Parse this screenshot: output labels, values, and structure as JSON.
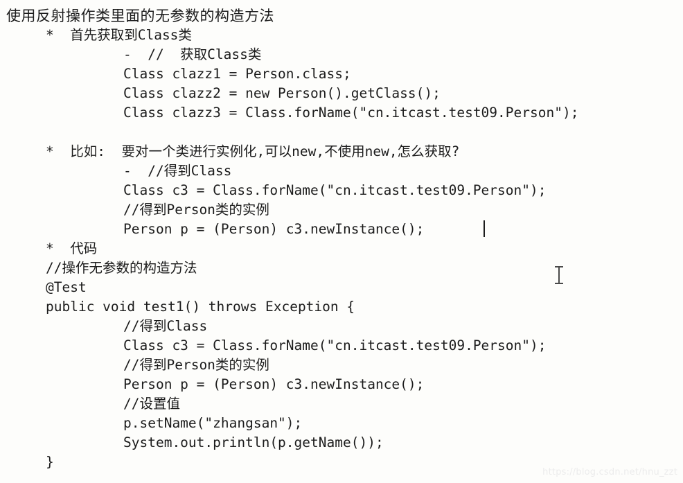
{
  "document": {
    "title_line": "使用反射操作类里面的无参数的构造方法",
    "watermark": "https://blog.csdn.net/hnu_zzt",
    "background_color": "#fdfdfb",
    "text_color": "#1c1c1c",
    "lines": [
      {
        "text": "使用反射操作类里面的无参数的构造方法",
        "indent": 0,
        "title": true,
        "italic": false,
        "blank": false
      },
      {
        "text": "*  首先获取到Class类",
        "indent": 1,
        "title": false,
        "italic": false,
        "blank": false
      },
      {
        "text": "-  //  获取Class类",
        "indent": 2,
        "title": false,
        "italic": false,
        "blank": false
      },
      {
        "text": "Class clazz1 = Person.class;",
        "indent": 2,
        "title": false,
        "italic": false,
        "blank": false
      },
      {
        "text": "Class clazz2 = new Person().getClass();",
        "indent": 2,
        "title": false,
        "italic": false,
        "blank": false
      },
      {
        "text": "Class clazz3 = Class.forName(\"cn.itcast.test09.Person\");",
        "indent": 2,
        "title": false,
        "italic": false,
        "blank": false
      },
      {
        "text": " ",
        "indent": 0,
        "title": false,
        "italic": false,
        "blank": true
      },
      {
        "text": "*  比如:  要对一个类进行实例化,可以new,不使用new,怎么获取?",
        "indent": 1,
        "title": false,
        "italic": false,
        "blank": false
      },
      {
        "text": "-  //得到Class",
        "indent": 2,
        "title": false,
        "italic": false,
        "blank": false
      },
      {
        "text": "Class c3 = Class.forName(\"cn.itcast.test09.Person\");",
        "indent": 2,
        "title": false,
        "italic": false,
        "blank": false
      },
      {
        "text": "//得到Person类的实例",
        "indent": 2,
        "title": false,
        "italic": false,
        "blank": false
      },
      {
        "text": "Person p = (Person) c3.newInstance();",
        "indent": 2,
        "title": false,
        "italic": false,
        "blank": false
      },
      {
        "text": "*  代码",
        "indent": 1,
        "title": false,
        "italic": false,
        "blank": false
      },
      {
        "text": "//操作无参数的构造方法",
        "indent": 1,
        "title": false,
        "italic": false,
        "blank": false
      },
      {
        "text": "@Test",
        "indent": 1,
        "title": false,
        "italic": false,
        "blank": false
      },
      {
        "text": "public void test1() throws Exception {",
        "indent": 1,
        "title": false,
        "italic": false,
        "blank": false
      },
      {
        "text": "//得到Class",
        "indent": 2,
        "title": false,
        "italic": false,
        "blank": false
      },
      {
        "text": "Class c3 = Class.forName(\"cn.itcast.test09.Person\");",
        "indent": 2,
        "title": false,
        "italic": false,
        "blank": false
      },
      {
        "text": "//得到Person类的实例",
        "indent": 2,
        "title": false,
        "italic": false,
        "blank": false
      },
      {
        "text": "Person p = (Person) c3.newInstance();",
        "indent": 2,
        "title": false,
        "italic": false,
        "blank": false
      },
      {
        "text": "//设置值",
        "indent": 2,
        "title": false,
        "italic": false,
        "blank": false
      },
      {
        "text": "p.setName(\"zhangsan\");",
        "indent": 2,
        "title": false,
        "italic": false,
        "blank": false
      },
      {
        "text": "System.out.println(p.getName());",
        "indent": 2,
        "title": false,
        "italic": false,
        "blank": false
      },
      {
        "text": "}",
        "indent": 1,
        "title": false,
        "italic": false,
        "blank": false
      }
    ]
  },
  "cursors": {
    "text_caret": {
      "line_index": 11,
      "after_text": "Person p = (Person) c3.newInstance();"
    },
    "mouse_pointer_icon": "i-beam-cursor"
  }
}
